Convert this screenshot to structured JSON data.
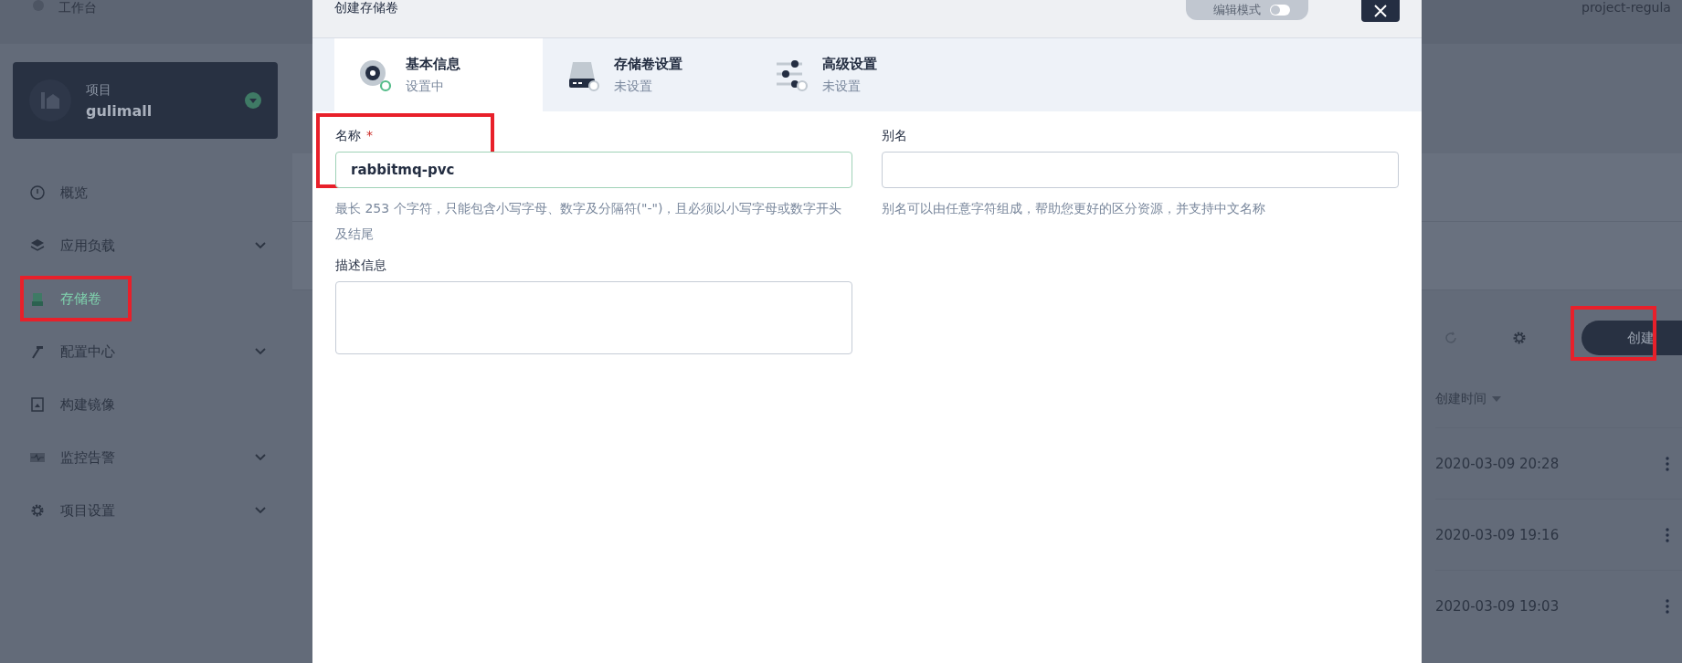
{
  "topbar": {
    "workbench": "工作台",
    "project": "project-regula"
  },
  "sidebar": {
    "project_card": {
      "label": "项目",
      "name": "gulimall"
    },
    "items": [
      {
        "label": "概览",
        "selected": false,
        "expandable": false,
        "annotated": false
      },
      {
        "label": "应用负载",
        "selected": false,
        "expandable": true,
        "annotated": false
      },
      {
        "label": "存储卷",
        "selected": true,
        "expandable": false,
        "annotated": true
      },
      {
        "label": "配置中心",
        "selected": false,
        "expandable": true,
        "annotated": false
      },
      {
        "label": "构建镜像",
        "selected": false,
        "expandable": false,
        "annotated": false
      },
      {
        "label": "监控告警",
        "selected": false,
        "expandable": true,
        "annotated": false
      },
      {
        "label": "项目设置",
        "selected": false,
        "expandable": true,
        "annotated": false
      }
    ]
  },
  "toolbar": {
    "create_button": {
      "label": "创建",
      "annotated": true
    }
  },
  "table": {
    "columns": [
      {
        "label": "创建时间",
        "sorted": true
      }
    ],
    "rows": [
      {
        "created": "2020-03-09 20:28"
      },
      {
        "created": "2020-03-09 19:16"
      },
      {
        "created": "2020-03-09 19:03"
      }
    ]
  },
  "modal": {
    "title": "创建存储卷",
    "edit_mode": {
      "label": "编辑模式",
      "on": false
    },
    "steps": [
      {
        "title": "基本信息",
        "status": "设置中",
        "selected": true
      },
      {
        "title": "存储卷设置",
        "status": "未设置",
        "selected": false
      },
      {
        "title": "高级设置",
        "status": "未设置",
        "selected": false
      }
    ],
    "form": {
      "name": {
        "label": "名称",
        "required_mark": "*",
        "value": "rabbitmq-pvc",
        "annotated": true,
        "hint": "最长 253 个字符，只能包含小写字母、数字及分隔符(\"-\")，且必须以小写字母或数字开头及结尾"
      },
      "alias": {
        "label": "别名",
        "hint": "别名可以由任意字符组成，帮助您更好的区分资源，并支持中文名称"
      },
      "description": {
        "label": "描述信息"
      }
    }
  }
}
